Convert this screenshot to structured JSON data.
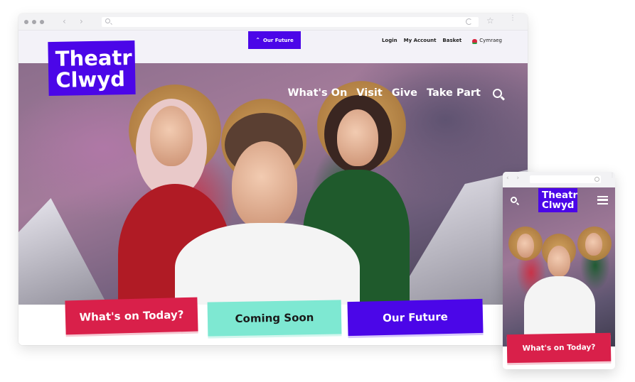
{
  "desktop": {
    "browser": {
      "window_controls": [
        "close",
        "minimize",
        "maximize"
      ],
      "nav": {
        "back_icon": "chevron-left-icon",
        "forward_icon": "chevron-right-icon"
      },
      "url_placeholder": "",
      "icons": {
        "search": "search-icon",
        "reload": "reload-icon",
        "bookmark": "star-icon",
        "menu": "kebab-icon"
      },
      "glyphs": {
        "back": "‹",
        "forward": "›",
        "star": "☆",
        "kebab": "⋮"
      }
    },
    "site": {
      "top_tab": {
        "label": "Our Future",
        "icon": "chevron-up-icon",
        "glyph": "^"
      },
      "utility_links": [
        {
          "label": "Login"
        },
        {
          "label": "My Account"
        },
        {
          "label": "Basket"
        }
      ],
      "language": {
        "label": "Cymraeg",
        "icon": "welsh-dragon-icon"
      },
      "logo": {
        "line1": "Theatr",
        "line2": "Clwyd"
      },
      "main_nav": [
        {
          "label": "What's On"
        },
        {
          "label": "Visit"
        },
        {
          "label": "Give"
        },
        {
          "label": "Take Part"
        }
      ],
      "search_icon": "search-icon",
      "cta_buttons": [
        {
          "label": "What's on Today?",
          "color": "#d9204a"
        },
        {
          "label": "Coming Soon",
          "color": "#7ee8d2"
        },
        {
          "label": "Our Future",
          "color": "#4b06e8"
        }
      ]
    }
  },
  "mobile": {
    "browser": {
      "glyphs": {
        "arrows": "‹ ›",
        "kebab": "⋮"
      }
    },
    "site": {
      "logo": {
        "line1": "Theatr",
        "line2": "Clwyd"
      },
      "search_icon": "search-icon",
      "menu_icon": "hamburger-icon",
      "cta": {
        "label": "What's on Today?",
        "color": "#d9204a"
      }
    }
  },
  "colors": {
    "brand_purple": "#4b06e8",
    "red": "#d9204a",
    "teal": "#7ee8d2"
  }
}
